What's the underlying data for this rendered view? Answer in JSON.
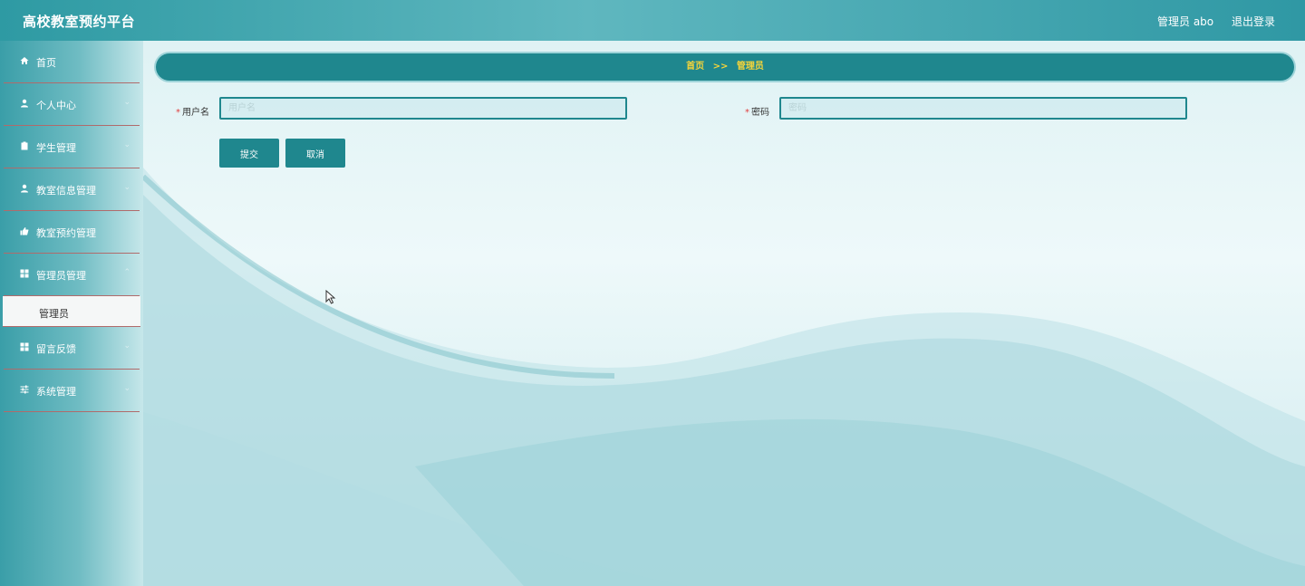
{
  "header": {
    "app_title": "高校教室预约平台",
    "user_label": "管理员 abo",
    "logout_label": "退出登录"
  },
  "sidebar": {
    "items": [
      {
        "label": "首页",
        "icon": "home-icon"
      },
      {
        "label": "个人中心",
        "icon": "user-icon"
      },
      {
        "label": "学生管理",
        "icon": "clipboard-icon"
      },
      {
        "label": "教室信息管理",
        "icon": "user-icon"
      },
      {
        "label": "教室预约管理",
        "icon": "thumb-icon"
      },
      {
        "label": "管理员管理",
        "icon": "grid-icon"
      },
      {
        "label": "留言反馈",
        "icon": "grid-icon"
      },
      {
        "label": "系统管理",
        "icon": "sliders-icon"
      }
    ],
    "active_sub_item": "管理员"
  },
  "breadcrumb": {
    "home": "首页",
    "separator": ">>",
    "current": "管理员"
  },
  "form": {
    "username": {
      "label": "用户名",
      "placeholder": "用户名",
      "value": ""
    },
    "password": {
      "label": "密码",
      "placeholder": "密码",
      "value": ""
    },
    "required_mark": "*",
    "submit_label": "提交",
    "cancel_label": "取消"
  },
  "colors": {
    "accent": "#1f878e",
    "breadcrumb_text": "#f5d43a",
    "required": "#e04040"
  }
}
